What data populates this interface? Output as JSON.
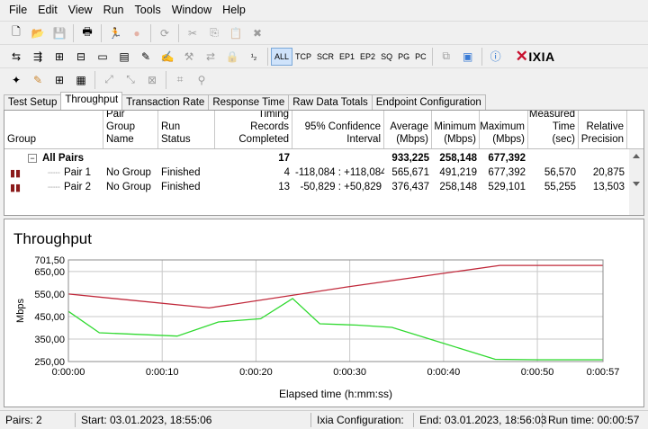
{
  "menu": [
    "File",
    "Edit",
    "View",
    "Run",
    "Tools",
    "Window",
    "Help"
  ],
  "protocol_buttons": [
    "ALL",
    "TCP",
    "SCR",
    "EP1",
    "EP2",
    "SQ",
    "PG",
    "PC"
  ],
  "brand": "IXIA",
  "tabs": [
    "Test Setup",
    "Throughput",
    "Transaction Rate",
    "Response Time",
    "Raw Data Totals",
    "Endpoint Configuration"
  ],
  "grid": {
    "headers": {
      "group": "Group",
      "pair_group_name": "Pair Group Name",
      "run_status": "Run Status",
      "timing_records": "Timing Records Completed",
      "confidence": "95% Confidence Interval",
      "average": "Average (Mbps)",
      "minimum": "Minimum (Mbps)",
      "maximum": "Maximum (Mbps)",
      "measured_time": "Measured Time (sec)",
      "relative_precision": "Relative Precision"
    },
    "all_pairs": {
      "toggle": "−",
      "label": "All Pairs",
      "records": "17",
      "average": "933,225",
      "minimum": "258,148",
      "maximum": "677,392"
    },
    "rows": [
      {
        "pair": "Pair 1",
        "group": "No Group",
        "status": "Finished",
        "records": "4",
        "confidence": "-118,084 : +118,084",
        "average": "565,671",
        "minimum": "491,219",
        "maximum": "677,392",
        "time": "56,570",
        "precision": "20,875"
      },
      {
        "pair": "Pair 2",
        "group": "No Group",
        "status": "Finished",
        "records": "13",
        "confidence": "-50,829 : +50,829",
        "average": "376,437",
        "minimum": "258,148",
        "maximum": "529,101",
        "time": "55,255",
        "precision": "13,503"
      }
    ]
  },
  "chart_data": {
    "type": "line",
    "title": "Throughput",
    "xlabel": "Elapsed time (h:mm:ss)",
    "ylabel": "Mbps",
    "ylim": [
      250,
      701.5
    ],
    "xlim": [
      0,
      57
    ],
    "yticks": [
      "701,50",
      "650,00",
      "550,00",
      "450,00",
      "350,00",
      "250,00"
    ],
    "ytick_values": [
      701.5,
      650,
      550,
      450,
      350,
      250
    ],
    "xticks": [
      "0:00:00",
      "0:00:10",
      "0:00:20",
      "0:00:30",
      "0:00:40",
      "0:00:50",
      "0:00:57"
    ],
    "xtick_values": [
      0,
      10,
      20,
      30,
      40,
      50,
      57
    ],
    "grid": true,
    "series": [
      {
        "color": "#c0283a",
        "x": [
          0,
          15,
          29.5,
          46,
          57
        ],
        "y": [
          550,
          488,
          580,
          677,
          677
        ]
      },
      {
        "color": "#2fd92f",
        "x": [
          0,
          3.3,
          11.6,
          16,
          20.5,
          23.9,
          26.8,
          30.8,
          34.5,
          45.5,
          50,
          57
        ],
        "y": [
          473,
          378,
          363,
          426,
          440,
          530,
          418,
          412,
          402,
          260,
          258,
          258
        ]
      }
    ]
  },
  "status": {
    "pairs": "Pairs: 2",
    "start": "Start: 03.01.2023, 18:55:06",
    "ixia_config": "Ixia Configuration:",
    "end": "End: 03.01.2023, 18:56:03",
    "run_time": "Run time: 00:00:57"
  },
  "colors": {
    "accent": "#c8102e",
    "series1": "#c0283a",
    "series2": "#2fd92f"
  }
}
